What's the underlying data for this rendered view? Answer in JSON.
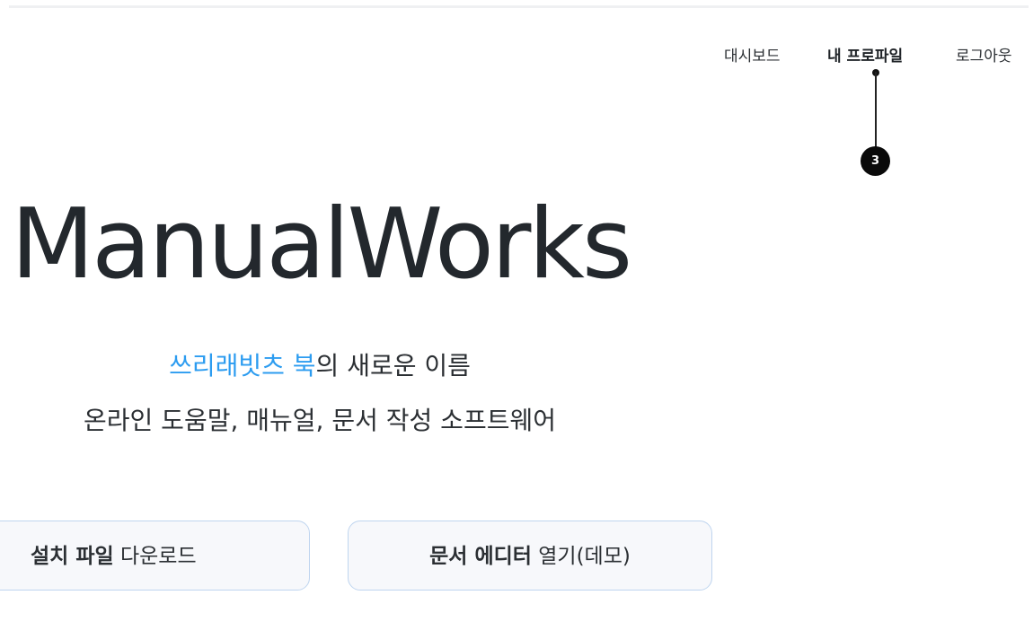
{
  "nav": {
    "dashboard": "대시보드",
    "profile": "내 프로파일",
    "logout": "로그아웃"
  },
  "callout": {
    "number": "3"
  },
  "hero": {
    "brand": "ManualWorks",
    "tagline_accent": "쓰리래빗츠 북",
    "tagline_rest": "의 새로운 이름",
    "subtitle": "온라인 도움말, 매뉴얼, 문서 작성 소프트웨어"
  },
  "buttons": {
    "download_bold": "설치 파일",
    "download_rest": " 다운로드",
    "editor_bold": "문서 에디터",
    "editor_rest": " 열기(데모)"
  },
  "colors": {
    "accent": "#2c9cf0",
    "text": "#23282d",
    "button_border": "#bfd5ef"
  }
}
